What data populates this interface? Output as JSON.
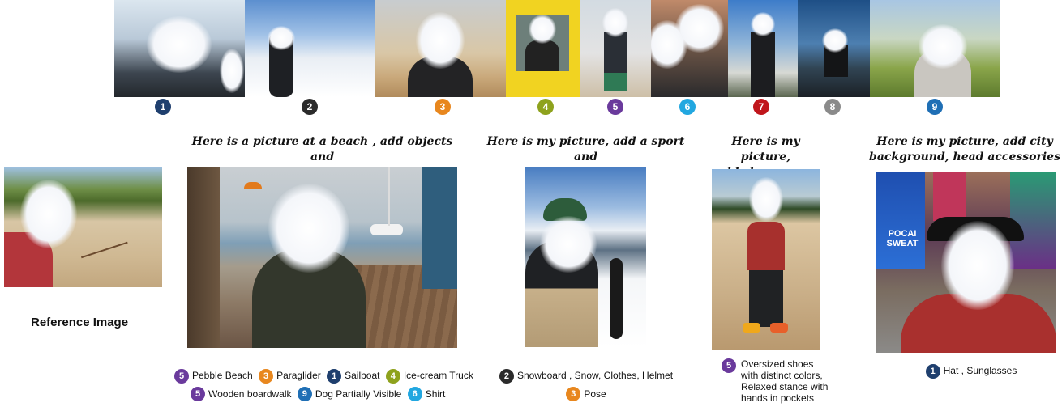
{
  "colors": {
    "1": "#1f3f6e",
    "2": "#2b2b2b",
    "3": "#e8871e",
    "4": "#8ea21d",
    "5": "#6a3a9c",
    "6": "#22a7e0",
    "7": "#c0161c",
    "8": "#8a8a8a",
    "9": "#1f6fb5"
  },
  "strip": {
    "badges": [
      "1",
      "2",
      "3",
      "4",
      "5",
      "6",
      "7",
      "8",
      "9"
    ]
  },
  "reference": {
    "label": "Reference Image"
  },
  "panels": [
    {
      "prompt_line1": "Here is a picture at a beach , add objects and",
      "prompt_line2": "actions",
      "legend_row1": [
        {
          "num": "5",
          "text": "Pebble Beach"
        },
        {
          "num": "3",
          "text": "Paraglider"
        },
        {
          "num": "1",
          "text": "Sailboat"
        },
        {
          "num": "4",
          "text": "Ice-cream Truck"
        }
      ],
      "legend_row2": [
        {
          "num": "5",
          "text": "Wooden boardwalk"
        },
        {
          "num": "9",
          "text": "Dog Partially Visible"
        },
        {
          "num": "6",
          "text": "Shirt"
        }
      ]
    },
    {
      "prompt_line1": "Here is my picture, add a sport and",
      "prompt_line2": "environment",
      "legend_row1": [
        {
          "num": "2",
          "text": "Snowboard , Snow, Clothes, Helmet"
        }
      ],
      "legend_row2": [
        {
          "num": "3",
          "text": "Pose"
        }
      ]
    },
    {
      "prompt_line1": "Here is my picture,",
      "prompt_line2": "add shoes, pose",
      "legend_num": "5",
      "legend_lines": [
        "Oversized shoes",
        "with distinct colors,",
        "Relaxed stance with",
        "hands in pockets"
      ]
    },
    {
      "prompt_line1": "Here is my picture, add city",
      "prompt_line2": "background, head accessories",
      "legend_row1": [
        {
          "num": "1",
          "text": "Hat , Sunglasses"
        }
      ]
    }
  ],
  "photo_texts": {
    "billboard_line1": "POCAI",
    "billboard_line2": "SWEAT"
  }
}
